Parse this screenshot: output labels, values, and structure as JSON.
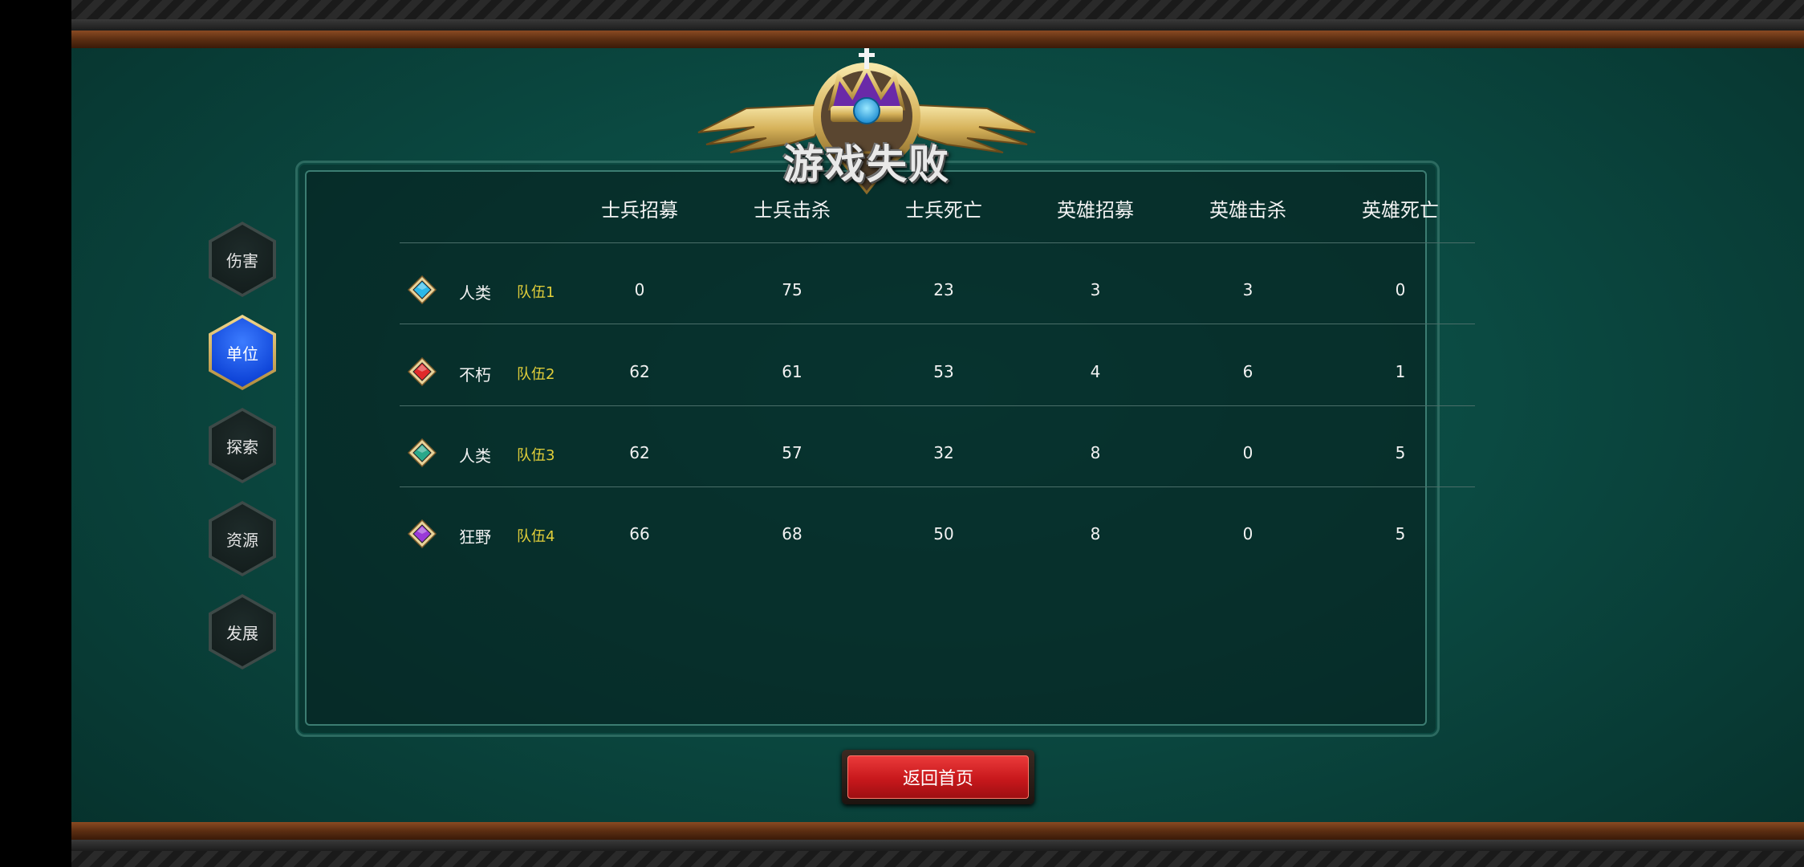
{
  "title": "游戏失败",
  "nav": [
    {
      "label": "伤害",
      "active": false
    },
    {
      "label": "单位",
      "active": true
    },
    {
      "label": "探索",
      "active": false
    },
    {
      "label": "资源",
      "active": false
    },
    {
      "label": "发展",
      "active": false
    }
  ],
  "columns": [
    "士兵招募",
    "士兵击杀",
    "士兵死亡",
    "英雄招募",
    "英雄击杀",
    "英雄死亡"
  ],
  "rows": [
    {
      "race": "人类",
      "team": "队伍1",
      "gem_color": "#2bb8e8",
      "values": [
        "0",
        "75",
        "23",
        "3",
        "3",
        "0"
      ]
    },
    {
      "race": "不朽",
      "team": "队伍2",
      "gem_color": "#e02a2a",
      "values": [
        "62",
        "61",
        "53",
        "4",
        "6",
        "1"
      ]
    },
    {
      "race": "人类",
      "team": "队伍3",
      "gem_color": "#2aa88a",
      "values": [
        "62",
        "57",
        "32",
        "8",
        "0",
        "5"
      ]
    },
    {
      "race": "狂野",
      "team": "队伍4",
      "gem_color": "#9a3ad8",
      "values": [
        "66",
        "68",
        "50",
        "8",
        "0",
        "5"
      ]
    }
  ],
  "home_button": "返回首页",
  "colors": {
    "team_label": "#e2cf3a",
    "button": "#c8181c",
    "active_tab": "#1046d9"
  }
}
